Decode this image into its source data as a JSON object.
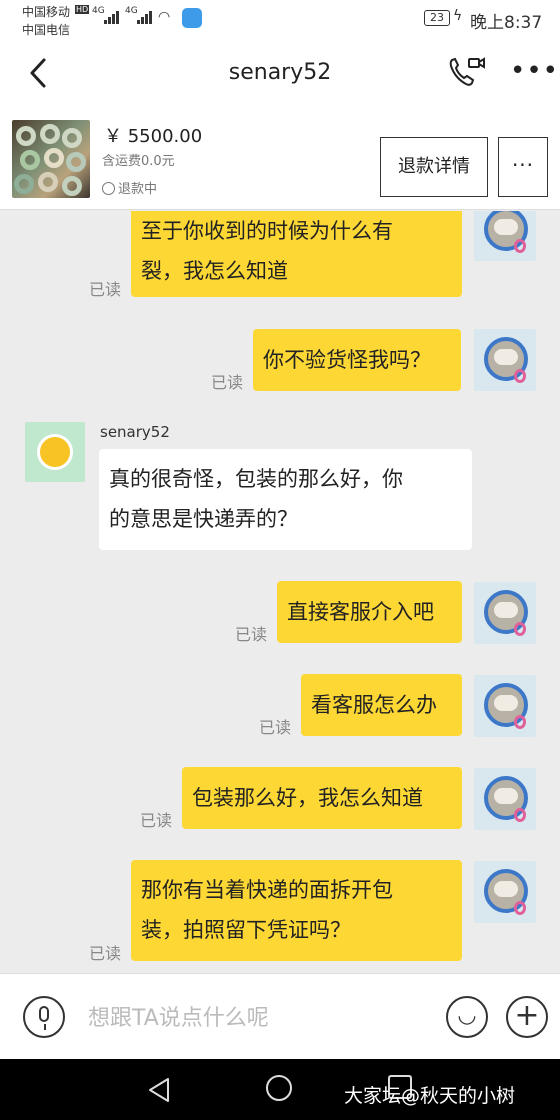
{
  "status_bar": {
    "carrier_1": "中国移动",
    "carrier_2": "中国电信",
    "hd_badge": "HD",
    "network_1": "4G",
    "network_2": "4G",
    "battery_level": "23",
    "time": "晚上8:37"
  },
  "header": {
    "title": "senary52",
    "back_icon": "chevron-left-icon",
    "call_icon": "phone-video-icon",
    "more_icon": "more-horizontal-icon"
  },
  "product": {
    "price": "￥ 5500.00",
    "shipping": "含运费0.0元",
    "status": "退款中",
    "refund_button": "退款详情",
    "more_button": "···"
  },
  "messages": [
    {
      "from": "me",
      "text": "至于你收到的时候为什么有裂，我怎么知道",
      "lines": [
        "至于你收到的时候为什么有",
        "裂，我怎么知道"
      ],
      "read": "已读"
    },
    {
      "from": "me",
      "text": "你不验货怪我吗？",
      "lines": [
        "你不验货怪我吗？"
      ],
      "read": "已读"
    },
    {
      "from": "them",
      "sender": "senary52",
      "text": "真的很奇怪，包装的那么好，你的意思是快递弄的？",
      "lines": [
        "真的很奇怪，包装的那么好，你",
        "的意思是快递弄的？"
      ]
    },
    {
      "from": "me",
      "text": "直接客服介入吧",
      "lines": [
        "直接客服介入吧"
      ],
      "read": "已读"
    },
    {
      "from": "me",
      "text": "看客服怎么办",
      "lines": [
        "看客服怎么办"
      ],
      "read": "已读"
    },
    {
      "from": "me",
      "text": "包装那么好，我怎么知道",
      "lines": [
        "包装那么好，我怎么知道"
      ],
      "read": "已读"
    },
    {
      "from": "me",
      "text": "那你有当着快递的面拆开包装，拍照留下凭证吗？",
      "lines": [
        "那你有当着快递的面拆开包",
        "装，拍照留下凭证吗？"
      ],
      "read": "已读"
    }
  ],
  "input": {
    "placeholder": "想跟TA说点什么呢",
    "mic_icon": "microphone-icon",
    "emoji_icon": "smiley-icon",
    "plus_icon": "plus-icon"
  },
  "nav": {
    "watermark": "大家坛@秋天的小树"
  },
  "colors": {
    "my_bubble": "#fdd835",
    "their_bubble": "#ffffff",
    "chat_bg": "#ececec"
  }
}
